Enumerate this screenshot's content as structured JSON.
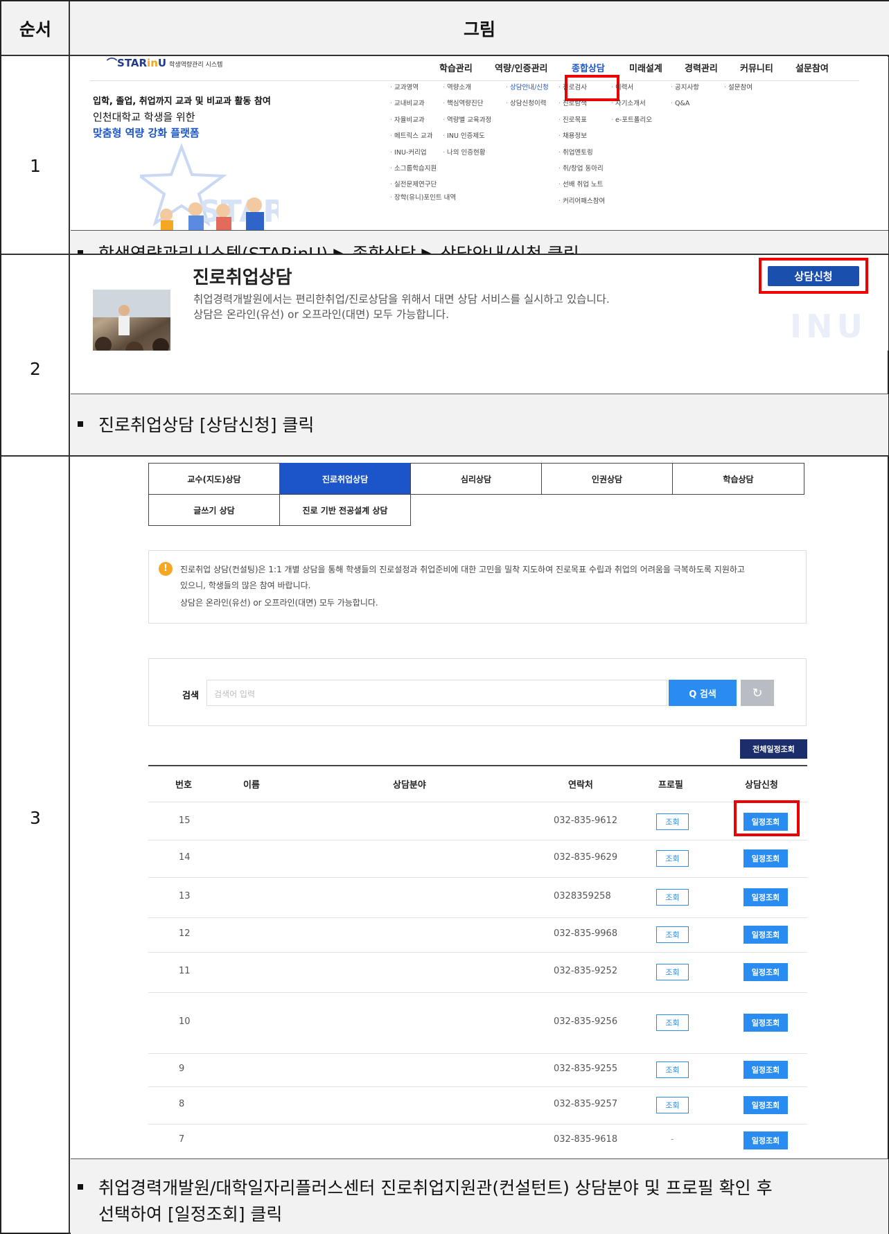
{
  "header": {
    "col_order": "순서",
    "col_image": "그림"
  },
  "steps": [
    {
      "num": "1",
      "desc": "학생역량관리시스템(STARinU) ▶ 종합상담 ▶ 상담안내/신청 클릭"
    },
    {
      "num": "2",
      "desc": "진로취업상담 [상담신청] 클릭"
    },
    {
      "num": "3",
      "desc_line1": "취업경력개발원/대학일자리플러스센터 진로취업지원관(컨설턴트) 상담분야 및 프로필 확인 후",
      "desc_line2": "선택하여 [일정조회] 클릭"
    }
  ],
  "step1": {
    "logo_main": "STAR",
    "logo_in": "in",
    "logo_u": "U",
    "logo_sub": "학생역량관리 시스템",
    "nav": [
      "학습관리",
      "역량/인증관리",
      "종합상담",
      "미래설계",
      "경력관리",
      "커뮤니티",
      "설문참여"
    ],
    "tagline1": "입학, 졸업, 취업까지 교과 및 비교과 활동 참여",
    "tagline2": "인천대학교 학생을 위한",
    "tagline3": "맞춤형 역량 강화 플랫폼",
    "illus_text": "STARinU",
    "menu": [
      [
        "교과영역",
        "교내비교과",
        "자율비교과",
        "메트릭스 교과",
        "INU-커리업",
        "소그룹학습지원",
        "실전문제연구단",
        "장학(유니)포인트 내역"
      ],
      [
        "역량소개",
        "핵심역량진단",
        "역량별 교육과정",
        "INU 인증제도",
        "나의 인증현황"
      ],
      [
        "상담안내/신청",
        "상담신청이력"
      ],
      [
        "진로검사",
        "진로탐색",
        "진로목표",
        "채용정보",
        "취업멘토링",
        "취/창업 동아리",
        "선배 취업 노트",
        "커리어패스참여"
      ],
      [
        "이력서",
        "자기소개서",
        "e-포트폴리오"
      ],
      [
        "공지사항",
        "Q&A"
      ],
      [
        "설문참여"
      ]
    ]
  },
  "step2": {
    "title": "진로취업상담",
    "line1": "취업경력개발원에서는 편리한취업/진로상담을 위해서 대면 상담 서비스를 실시하고 있습니다.",
    "line2": "상담은 온라인(유선) or 오프라인(대면) 모두 가능합니다.",
    "apply_btn": "상담신청",
    "watermark": "INU"
  },
  "step3": {
    "tabs_row1": [
      "교수(지도)상담",
      "진로취업상담",
      "심리상담",
      "인권상담",
      "학습상담"
    ],
    "tabs_row2": [
      "글쓰기 상담",
      "진로 기반 전공설계 상담"
    ],
    "notice_icon": "!",
    "notice_line1": "진로취업 상담(컨설팅)은 1:1 개별 상담을 통해 학생들의 진로설정과 취업준비에 대한 고민을 밀착 지도하여 진로목표 수립과 취업의 어려움을 극복하도록 지원하고",
    "notice_line2": "있으니, 학생들의 많은 참여 바랍니다.",
    "notice_line3": "상담은 온라인(유선) or 오프라인(대면) 모두 가능합니다.",
    "search_label": "검색",
    "search_placeholder": "검색어 입력",
    "search_btn": "Q 검색",
    "reset_icon": "↻",
    "all_schedule_btn": "전체일정조회",
    "columns": [
      "번호",
      "이름",
      "상담분야",
      "연락처",
      "프로필",
      "상담신청"
    ],
    "rows": [
      {
        "no": "15",
        "phone": "032-835-9612",
        "profile": "조회",
        "apply": "일정조회"
      },
      {
        "no": "14",
        "phone": "032-835-9629",
        "profile": "조회",
        "apply": "일정조회"
      },
      {
        "no": "13",
        "phone": "0328359258",
        "profile": "조회",
        "apply": "일정조회"
      },
      {
        "no": "12",
        "phone": "032-835-9968",
        "profile": "조회",
        "apply": "일정조회"
      },
      {
        "no": "11",
        "phone": "032-835-9252",
        "profile": "조회",
        "apply": "일정조회"
      },
      {
        "no": "10",
        "phone": "032-835-9256",
        "profile": "조회",
        "apply": "일정조회"
      },
      {
        "no": "9",
        "phone": "032-835-9255",
        "profile": "조회",
        "apply": "일정조회"
      },
      {
        "no": "8",
        "phone": "032-835-9257",
        "profile": "조회",
        "apply": "일정조회"
      },
      {
        "no": "7",
        "phone": "032-835-9618",
        "profile": "-",
        "apply": "일정조회"
      }
    ]
  },
  "colors": {
    "highlight": "#e00000",
    "primary": "#1c55c9",
    "button_blue": "#2a8cf0",
    "navy": "#1b2e6b"
  }
}
